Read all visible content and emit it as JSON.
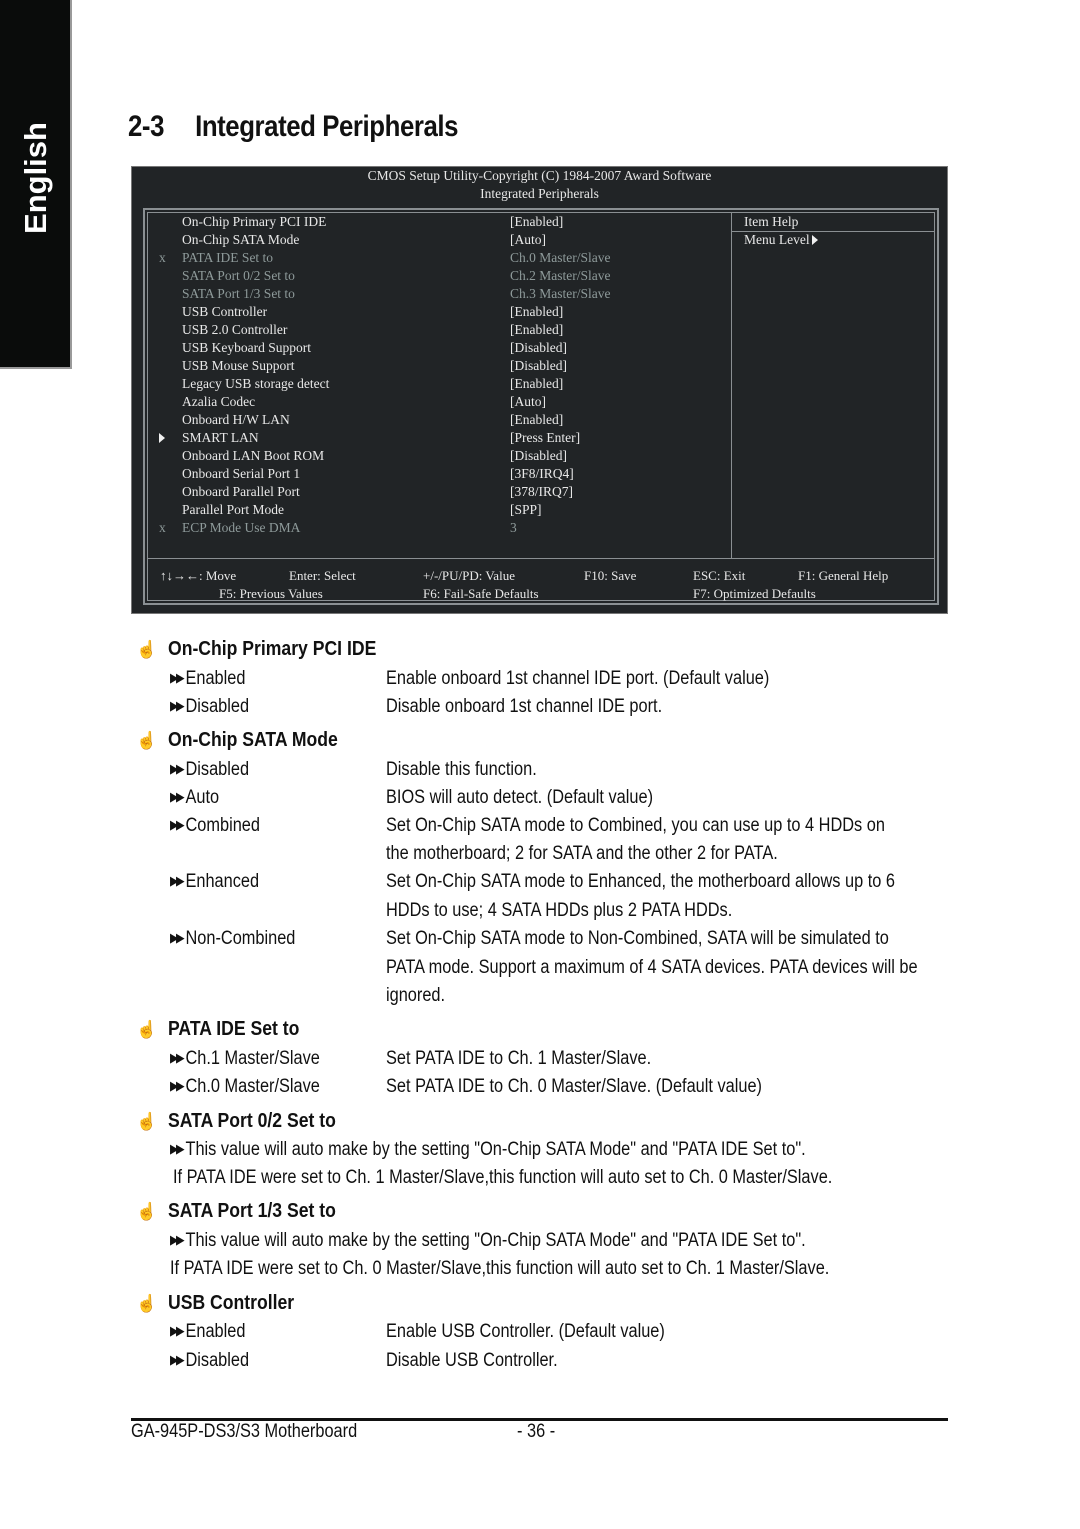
{
  "side_tab": {
    "label": "English"
  },
  "title": {
    "number": "2-3",
    "text": "Integrated Peripherals"
  },
  "bios": {
    "header_line1": "CMOS Setup Utility-Copyright (C) 1984-2007 Award Software",
    "header_line2": "Integrated Peripherals",
    "items": [
      {
        "mark": "",
        "label": "On-Chip Primary PCI IDE",
        "value": "[Enabled]",
        "dim": false
      },
      {
        "mark": "",
        "label": "On-Chip SATA Mode",
        "value": "[Auto]",
        "dim": false
      },
      {
        "mark": "x",
        "label": "PATA IDE Set to",
        "value": "Ch.0 Master/Slave",
        "dim": true
      },
      {
        "mark": "",
        "label": "SATA Port 0/2 Set to",
        "value": "Ch.2 Master/Slave",
        "dim": true
      },
      {
        "mark": "",
        "label": "SATA Port 1/3 Set to",
        "value": "Ch.3 Master/Slave",
        "dim": true
      },
      {
        "mark": "",
        "label": "USB Controller",
        "value": "[Enabled]",
        "dim": false
      },
      {
        "mark": "",
        "label": "USB 2.0 Controller",
        "value": "[Enabled]",
        "dim": false
      },
      {
        "mark": "",
        "label": "USB Keyboard Support",
        "value": "[Disabled]",
        "dim": false
      },
      {
        "mark": "",
        "label": "USB Mouse Support",
        "value": "[Disabled]",
        "dim": false
      },
      {
        "mark": "",
        "label": "Legacy USB storage detect",
        "value": "[Enabled]",
        "dim": false
      },
      {
        "mark": "",
        "label": "Azalia Codec",
        "value": "[Auto]",
        "dim": false
      },
      {
        "mark": "",
        "label": "Onboard H/W LAN",
        "value": "[Enabled]",
        "dim": false
      },
      {
        "mark": "submenu",
        "label": "SMART LAN",
        "value": "[Press Enter]",
        "dim": false
      },
      {
        "mark": "",
        "label": "Onboard LAN Boot ROM",
        "value": "[Disabled]",
        "dim": false
      },
      {
        "mark": "",
        "label": "Onboard Serial Port 1",
        "value": "[3F8/IRQ4]",
        "dim": false
      },
      {
        "mark": "",
        "label": "Onboard Parallel Port",
        "value": "[378/IRQ7]",
        "dim": false
      },
      {
        "mark": "",
        "label": "Parallel Port Mode",
        "value": "[SPP]",
        "dim": false
      },
      {
        "mark": "x",
        "label": "ECP Mode Use DMA",
        "value": "3",
        "dim": true
      }
    ],
    "help_title": "Item Help",
    "help_menu_level": "Menu Level",
    "keys": {
      "move": "↑↓→←: Move",
      "enter": "Enter: Select",
      "value": "+/-/PU/PD: Value",
      "f10": "F10: Save",
      "esc": "ESC: Exit",
      "f1": "F1: General Help",
      "f5": "F5: Previous Values",
      "f6": "F6: Fail-Safe Defaults",
      "f7": "F7: Optimized Defaults"
    }
  },
  "sections": {
    "primary_pci_ide": {
      "title": "On-Chip Primary PCI IDE",
      "options": [
        {
          "name": "Enabled",
          "desc": [
            "Enable onboard 1st channel IDE port. (Default value)"
          ]
        },
        {
          "name": "Disabled",
          "desc": [
            "Disable onboard 1st channel IDE port."
          ]
        }
      ]
    },
    "sata_mode": {
      "title": "On-Chip SATA Mode",
      "options": [
        {
          "name": "Disabled",
          "desc": [
            "Disable this function."
          ]
        },
        {
          "name": "Auto",
          "desc": [
            "BIOS will auto detect. (Default value)"
          ]
        },
        {
          "name": "Combined",
          "desc": [
            "Set On-Chip SATA mode to Combined, you can use up to 4 HDDs on",
            "the motherboard; 2 for SATA and the other 2 for PATA."
          ]
        },
        {
          "name": "Enhanced",
          "desc": [
            "Set On-Chip SATA mode to Enhanced, the motherboard allows up to 6",
            "HDDs to use; 4 SATA HDDs plus 2 PATA HDDs."
          ]
        },
        {
          "name": "Non-Combined",
          "desc": [
            "Set On-Chip SATA mode to Non-Combined, SATA will be simulated to",
            "PATA mode. Support a maximum of 4 SATA devices. PATA devices will be",
            "ignored."
          ]
        }
      ]
    },
    "pata_ide": {
      "title": "PATA IDE Set to",
      "options": [
        {
          "name": "Ch.1 Master/Slave",
          "desc": [
            "Set PATA IDE to Ch. 1 Master/Slave."
          ]
        },
        {
          "name": "Ch.0 Master/Slave",
          "desc": [
            "Set PATA IDE to Ch. 0 Master/Slave. (Default value)"
          ]
        }
      ]
    },
    "sata_port_02": {
      "title": "SATA Port 0/2 Set to",
      "line1": "This value will auto make by the setting \"On-Chip SATA Mode\" and \"PATA IDE Set to\".",
      "line2": "If PATA IDE were set to Ch. 1 Master/Slave,this function will auto set to Ch. 0 Master/Slave."
    },
    "sata_port_13": {
      "title": "SATA Port 1/3 Set to",
      "line1": "This value will auto make by the setting \"On-Chip SATA Mode\" and \"PATA IDE Set to\".",
      "line2": "If PATA IDE were set to Ch. 0 Master/Slave,this function will auto set to Ch. 1 Master/Slave."
    },
    "usb_controller": {
      "title": "USB Controller",
      "options": [
        {
          "name": "Enabled",
          "desc": [
            "Enable USB Controller. (Default value)"
          ]
        },
        {
          "name": "Disabled",
          "desc": [
            "Disable USB Controller."
          ]
        }
      ]
    }
  },
  "footer": {
    "model": "GA-945P-DS3/S3 Motherboard",
    "page": "- 36 -"
  }
}
